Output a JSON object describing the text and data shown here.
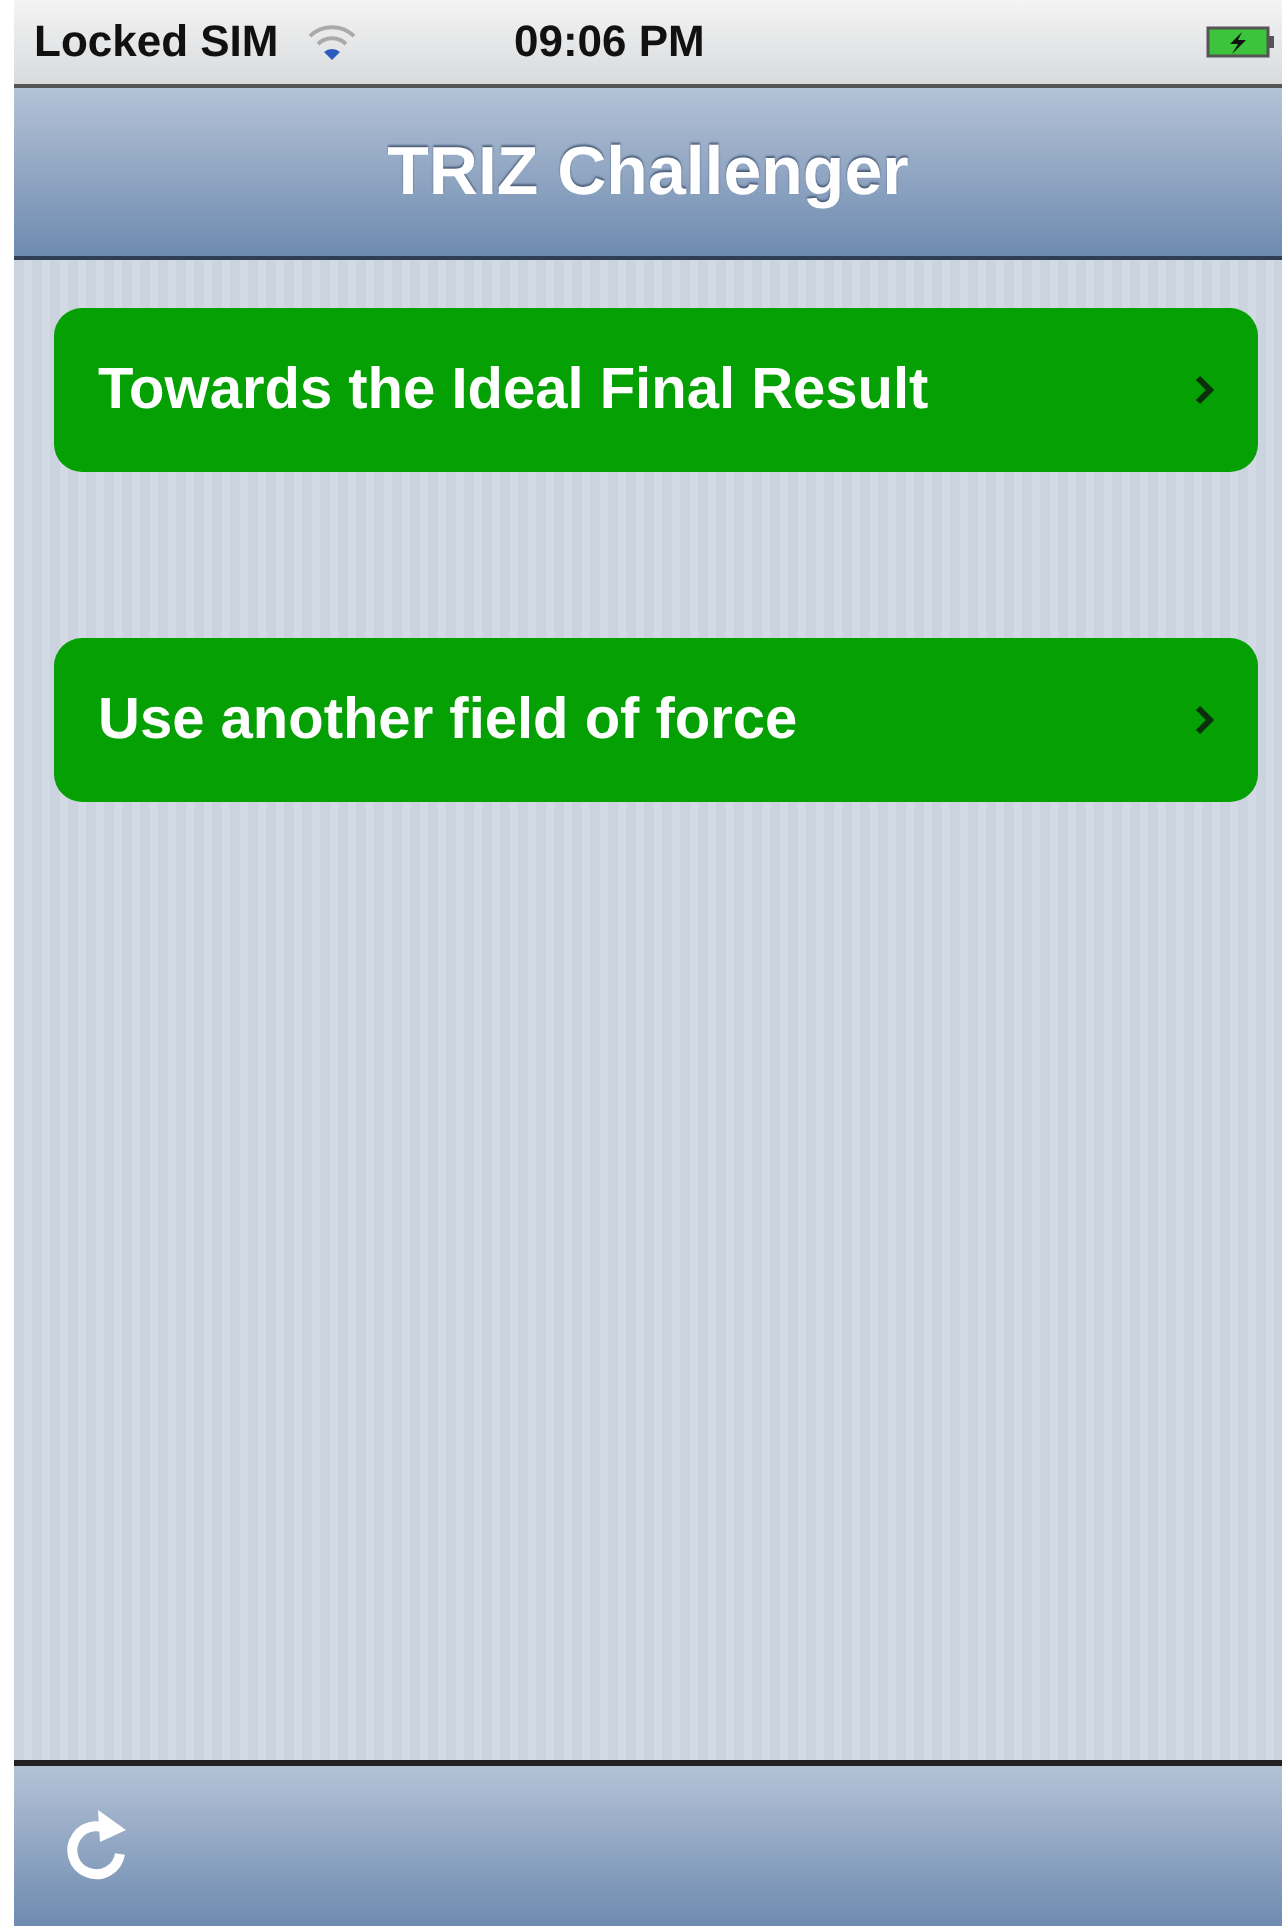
{
  "status_bar": {
    "carrier": "Locked SIM",
    "time": "09:06 PM"
  },
  "nav_bar": {
    "title": "TRIZ Challenger"
  },
  "items": [
    {
      "label": "Towards the Ideal Final Result"
    },
    {
      "label": "Use another field of force"
    }
  ],
  "toolbar": {
    "buttons": [
      {
        "kind": "refresh"
      }
    ]
  }
}
